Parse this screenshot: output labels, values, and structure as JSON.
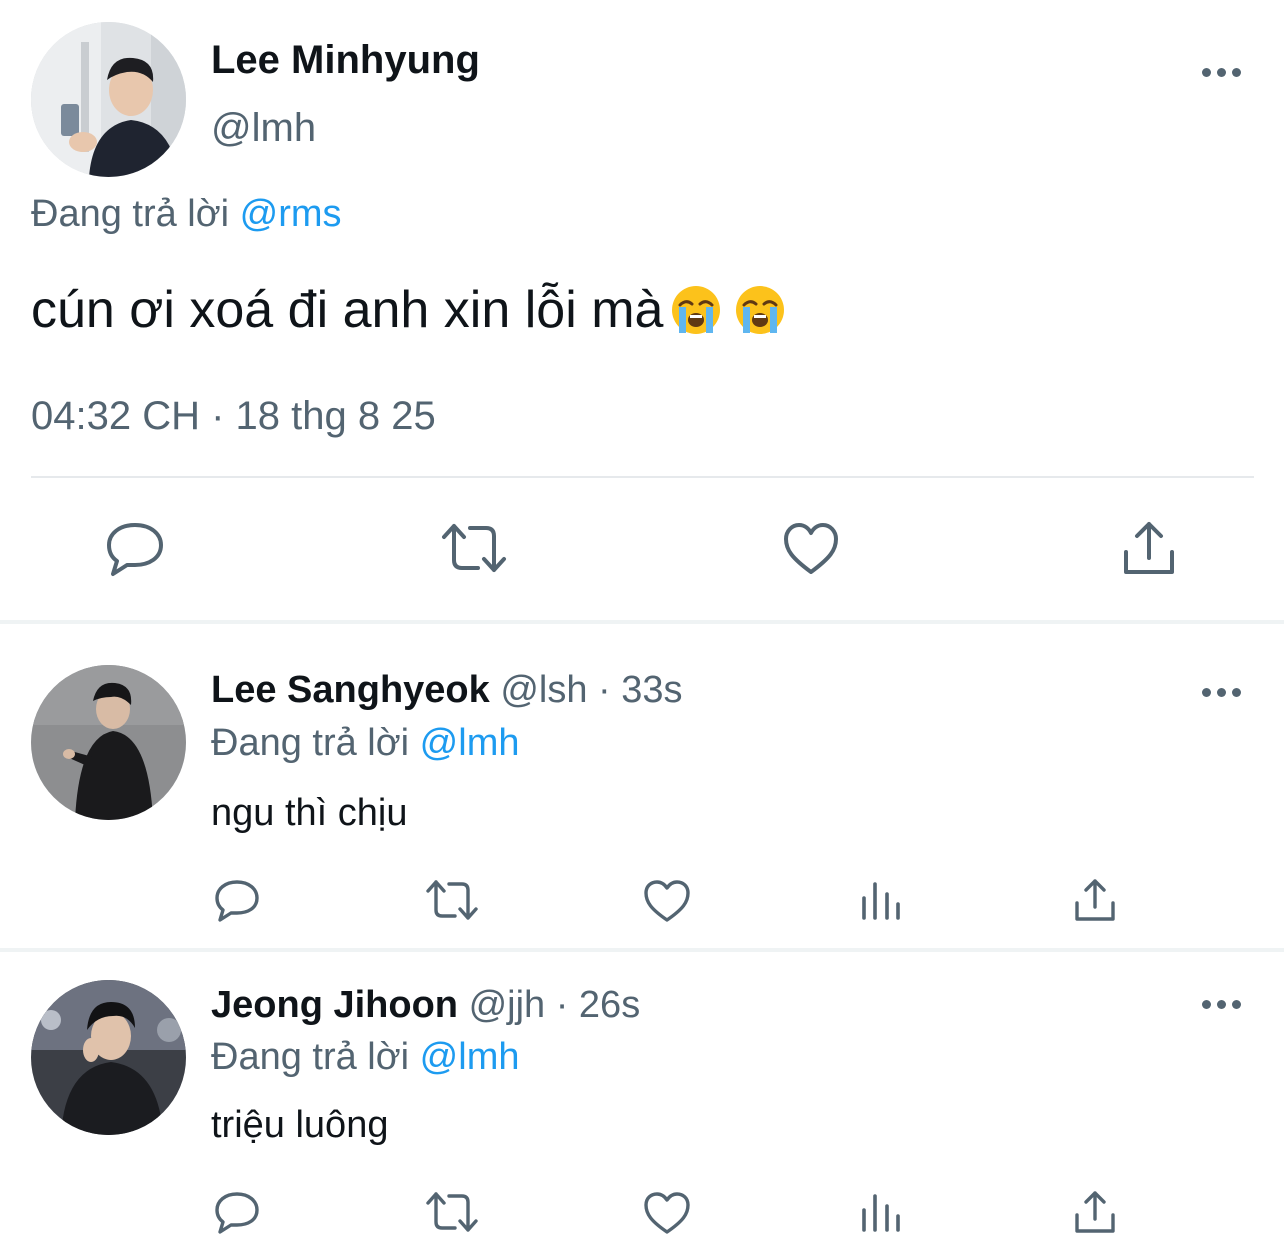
{
  "main_tweet": {
    "name": "Lee Minhyung",
    "handle": "@lmh",
    "reply_prefix": "Đang trả lời",
    "reply_to": "@rms",
    "text": "cún ơi xoá đi anh xin lỗi mà",
    "emojis": [
      "loudly-crying-face",
      "loudly-crying-face"
    ],
    "timestamp": "04:32 CH · 18 thg 8 25",
    "actions": [
      "reply",
      "retweet",
      "like",
      "share"
    ]
  },
  "replies": [
    {
      "name": "Lee Sanghyeok",
      "meta": "@lsh · 33s",
      "reply_prefix": "Đang trả lời",
      "reply_to": "@lmh",
      "text": "ngu thì chịu",
      "actions": [
        "reply",
        "retweet",
        "like",
        "views",
        "share"
      ]
    },
    {
      "name": "Jeong Jihoon",
      "meta": "@jjh · 26s",
      "reply_prefix": "Đang trả lời",
      "reply_to": "@lmh",
      "text": "triệu luông",
      "actions": [
        "reply",
        "retweet",
        "like",
        "views",
        "share"
      ]
    }
  ],
  "colors": {
    "text_primary": "#0f1419",
    "text_secondary": "#536471",
    "link": "#1d9bf0",
    "divider": "#eff3f4"
  }
}
